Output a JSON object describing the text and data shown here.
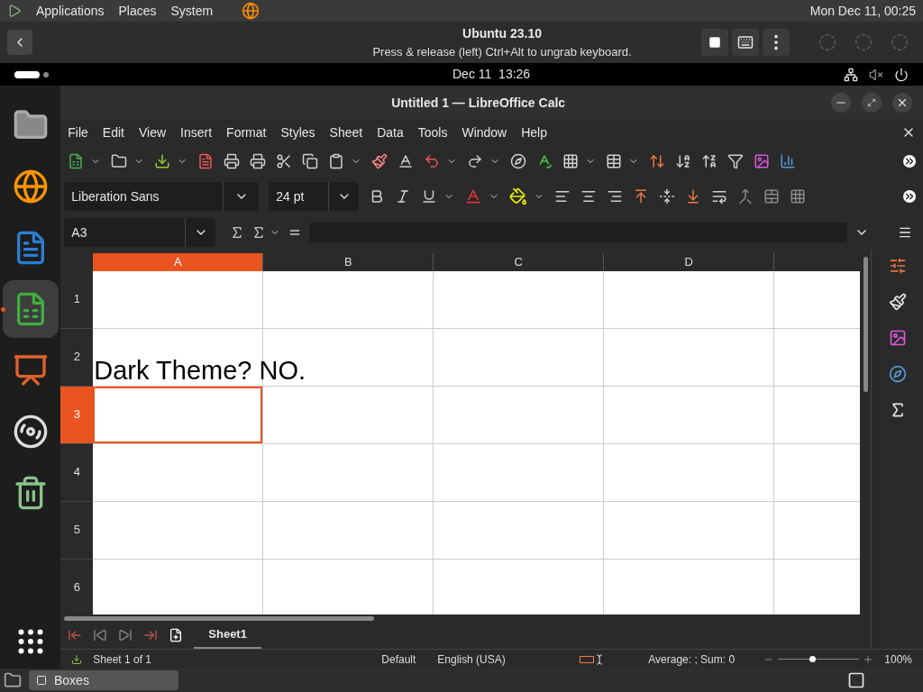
{
  "top_panel": {
    "menus": [
      "Applications",
      "Places",
      "System"
    ],
    "clock": "Mon Dec 11, 00:25"
  },
  "boxes_header": {
    "title": "Ubuntu 23.10",
    "subtitle": "Press & release (left) Ctrl+Alt to ungrab keyboard."
  },
  "gnome_bar": {
    "clock": "Dec 11  13:26"
  },
  "dock": [
    {
      "kind": "files",
      "selected": false,
      "running": false
    },
    {
      "kind": "firefox",
      "selected": false,
      "running": false
    },
    {
      "kind": "writer",
      "selected": false,
      "running": false
    },
    {
      "kind": "calc",
      "selected": true,
      "running": true
    },
    {
      "kind": "impress",
      "selected": false,
      "running": false
    },
    {
      "kind": "disc",
      "selected": false,
      "running": false
    },
    {
      "kind": "trash",
      "selected": false,
      "running": false
    }
  ],
  "window": {
    "title": "Untitled 1 — LibreOffice Calc"
  },
  "menu": [
    "File",
    "Edit",
    "View",
    "Insert",
    "Format",
    "Styles",
    "Sheet",
    "Data",
    "Tools",
    "Window",
    "Help"
  ],
  "font_name": "Liberation Sans",
  "font_size": "24 pt",
  "name_box": "A3",
  "columns": [
    {
      "label": "A",
      "selected": true
    },
    {
      "label": "B",
      "selected": false
    },
    {
      "label": "C",
      "selected": false
    },
    {
      "label": "D",
      "selected": false
    }
  ],
  "rows": [
    {
      "label": "1",
      "selected": false,
      "cells": []
    },
    {
      "label": "2",
      "selected": false,
      "cells": [
        "Dark Theme? NO."
      ]
    },
    {
      "label": "3",
      "selected": true,
      "cells": []
    },
    {
      "label": "4",
      "selected": false,
      "cells": []
    },
    {
      "label": "5",
      "selected": false,
      "cells": []
    },
    {
      "label": "6",
      "selected": false,
      "cells": []
    }
  ],
  "sheet_tabs": [
    {
      "label": "Sheet1",
      "selected": true
    }
  ],
  "status_bar": {
    "sheet": "Sheet 1 of 1",
    "style": "Default",
    "language": "English (USA)",
    "summary": "Average: ; Sum: 0",
    "zoom": "100%",
    "zoom_slider": {
      "level": 0.42
    }
  },
  "taskbar": {
    "items": [
      "Boxes"
    ]
  }
}
